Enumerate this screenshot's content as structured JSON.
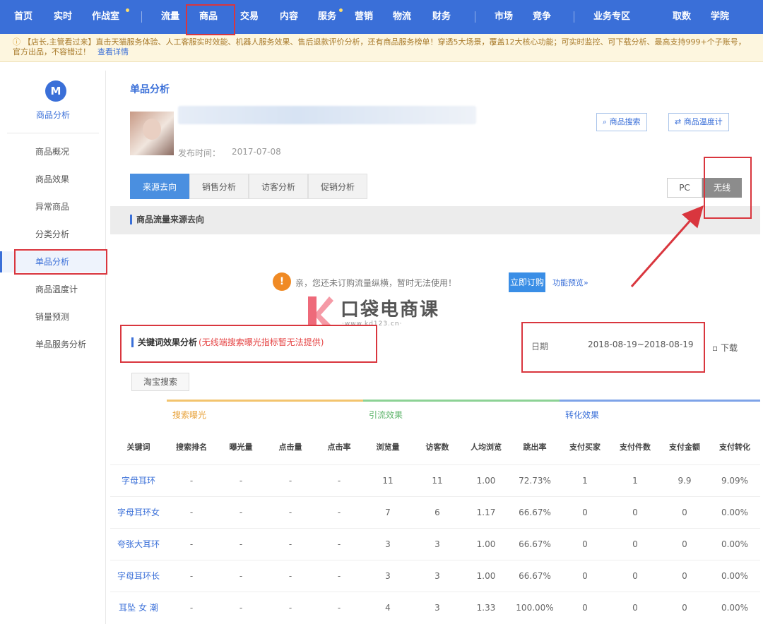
{
  "nav": {
    "items": [
      "首页",
      "实时",
      "作战室",
      "流量",
      "商品",
      "交易",
      "内容",
      "服务",
      "营销",
      "物流",
      "财务",
      "市场",
      "竞争",
      "业务专区",
      "取数",
      "学院"
    ]
  },
  "notice": {
    "text": "【店长,主管看过来】直击天猫服务体验、人工客服实时效能、机器人服务效果、售后退款评价分析，还有商品服务榜单！穿透5大场景，覆盖12大核心功能；可实时监控、可下载分析、最高支持999+个子账号，官方出品，不容错过！",
    "link": "查看详情"
  },
  "sidebar": {
    "logo": "M",
    "title": "商品分析",
    "items": [
      "商品概况",
      "商品效果",
      "异常商品",
      "分类分析",
      "单品分析",
      "商品温度计",
      "销量预测",
      "单品服务分析"
    ]
  },
  "main": {
    "page_title": "单品分析",
    "publish_label": "发布时间：",
    "publish_date": "2017-07-08",
    "btn_search": "商品搜索",
    "btn_thermo": "商品温度计",
    "tabs": [
      "来源去向",
      "销售分析",
      "访客分析",
      "促销分析"
    ],
    "seg_pc": "PC",
    "seg_wx": "无线",
    "section_title": "商品流量来源去向",
    "warn_icon": "!",
    "warn_text": "亲，您还未订购流量纵横，暂时无法使用！",
    "warn_btn": "立即订购",
    "warn_link": "功能预览»",
    "watermark": "口袋电商课",
    "watermark_url": "·www.kd123.cn·",
    "kw_title": "关键词效果分析",
    "kw_note": "(无线端搜索曝光指标暂无法提供)",
    "date_label": "日期",
    "date_value": "2018-08-19~2018-08-19",
    "download": "下载",
    "source_btn": "淘宝搜索"
  },
  "table": {
    "groups": [
      "搜索曝光",
      "引流效果",
      "转化效果"
    ],
    "headers": [
      "关键词",
      "搜索排名",
      "曝光量",
      "点击量",
      "点击率",
      "浏览量",
      "访客数",
      "人均浏览",
      "跳出率",
      "支付买家",
      "支付件数",
      "支付金额",
      "支付转化"
    ],
    "rows": [
      [
        "字母耳环",
        "-",
        "-",
        "-",
        "-",
        "11",
        "11",
        "1.00",
        "72.73%",
        "1",
        "1",
        "9.9",
        "9.09%"
      ],
      [
        "字母耳环女",
        "-",
        "-",
        "-",
        "-",
        "7",
        "6",
        "1.17",
        "66.67%",
        "0",
        "0",
        "0",
        "0.00%"
      ],
      [
        "夸张大耳环",
        "-",
        "-",
        "-",
        "-",
        "3",
        "3",
        "1.00",
        "66.67%",
        "0",
        "0",
        "0",
        "0.00%"
      ],
      [
        "字母耳环长",
        "-",
        "-",
        "-",
        "-",
        "3",
        "3",
        "1.00",
        "66.67%",
        "0",
        "0",
        "0",
        "0.00%"
      ],
      [
        "耳坠 女 潮",
        "-",
        "-",
        "-",
        "-",
        "4",
        "3",
        "1.33",
        "100.00%",
        "0",
        "0",
        "0",
        "0.00%"
      ]
    ]
  },
  "colors": {
    "brand": "#3a6fd8",
    "highlight": "#d9363e"
  }
}
